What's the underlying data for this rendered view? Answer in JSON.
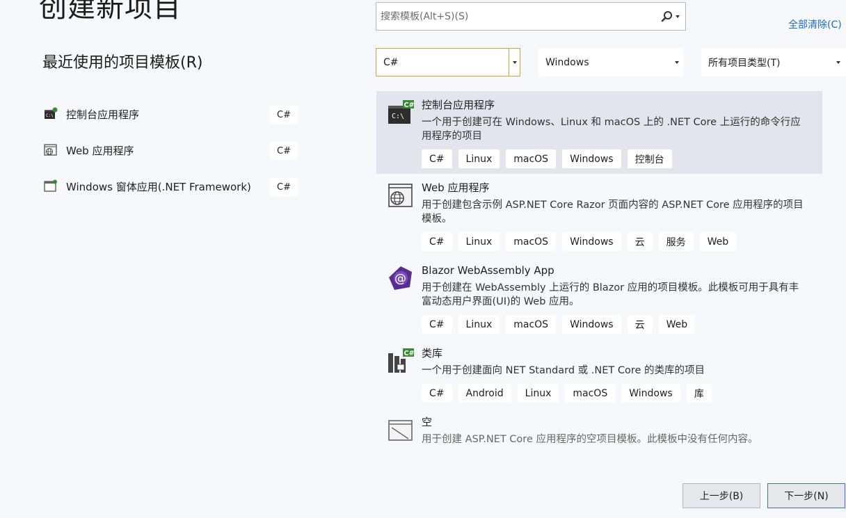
{
  "page": {
    "title": "创建新项目",
    "recent_title": "最近使用的项目模板(R)"
  },
  "recent": [
    {
      "name": "控制台应用程序",
      "lang": "C#",
      "icon": "console-app-icon"
    },
    {
      "name": "Web 应用程序",
      "lang": "C#",
      "icon": "web-app-icon"
    },
    {
      "name": "Windows 窗体应用(.NET Framework)",
      "lang": "C#",
      "icon": "windows-forms-icon"
    }
  ],
  "search": {
    "placeholder": "搜索模板(Alt+S)(S)"
  },
  "clear_all": "全部清除(C)",
  "filters": {
    "language": "C#",
    "platform": "Windows",
    "project_type": "所有项目类型(T)"
  },
  "templates": [
    {
      "name": "控制台应用程序",
      "desc": "一个用于创建可在 Windows、Linux 和 macOS 上的 .NET Core 上运行的命令行应用程序的项目",
      "tags": [
        "C#",
        "Linux",
        "macOS",
        "Windows",
        "控制台"
      ],
      "icon": "console-app-icon"
    },
    {
      "name": "Web 应用程序",
      "desc": "用于创建包含示例 ASP.NET Core Razor 页面内容的 ASP.NET Core 应用程序的项目模板。",
      "tags": [
        "C#",
        "Linux",
        "macOS",
        "Windows",
        "云",
        "服务",
        "Web"
      ],
      "icon": "web-app-icon"
    },
    {
      "name": "Blazor WebAssembly App",
      "desc": "用于创建在 WebAssembly 上运行的 Blazor 应用的项目模板。此模板可用于具有丰富动态用户界面(UI)的 Web 应用。",
      "tags": [
        "C#",
        "Linux",
        "macOS",
        "Windows",
        "云",
        "Web"
      ],
      "icon": "blazor-icon"
    },
    {
      "name": "类库",
      "desc": "一个用于创建面向 NET Standard 或 .NET Core 的类库的项目",
      "tags": [
        "C#",
        "Android",
        "Linux",
        "macOS",
        "Windows",
        "库"
      ],
      "icon": "class-library-icon"
    },
    {
      "name": "空",
      "desc": "用于创建 ASP.NET Core 应用程序的空项目模板。此模板中没有任何内容。",
      "tags": [],
      "icon": "empty-project-icon"
    }
  ],
  "buttons": {
    "back": "上一步(B)",
    "next": "下一步(N)"
  },
  "colors": {
    "accent": "#c9a43b",
    "link": "#1a6bc7",
    "selected": "#e2e5ec",
    "csharp_green": "#388a34",
    "blazor_purple": "#5c2d91"
  }
}
